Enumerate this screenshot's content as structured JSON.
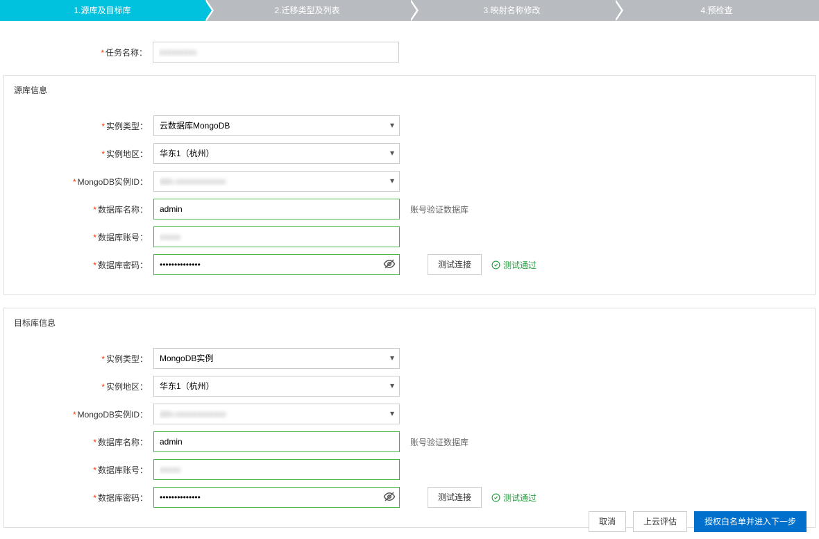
{
  "steps": {
    "s1": "1.源库及目标库",
    "s2": "2.迁移类型及列表",
    "s3": "3.映射名称修改",
    "s4": "4.预检查"
  },
  "task": {
    "label": "任务名称：",
    "value": "xxxxxxxxx"
  },
  "source": {
    "title": "源库信息",
    "instanceType": {
      "label": "实例类型：",
      "value": "云数据库MongoDB"
    },
    "region": {
      "label": "实例地区：",
      "value": "华东1（杭州）"
    },
    "instanceId": {
      "label": "MongoDB实例ID：",
      "value": "dds-xxxxxxxxxxxx"
    },
    "dbName": {
      "label": "数据库名称：",
      "value": "admin",
      "hint": "账号验证数据库"
    },
    "account": {
      "label": "数据库账号：",
      "value": "xxxxx"
    },
    "password": {
      "label": "数据库密码：",
      "value": "••••••••••••••"
    },
    "testBtn": "测试连接",
    "testResult": "测试通过"
  },
  "target": {
    "title": "目标库信息",
    "instanceType": {
      "label": "实例类型：",
      "value": "MongoDB实例"
    },
    "region": {
      "label": "实例地区：",
      "value": "华东1（杭州）"
    },
    "instanceId": {
      "label": "MongoDB实例ID：",
      "value": "dds-xxxxxxxxxxxx"
    },
    "dbName": {
      "label": "数据库名称：",
      "value": "admin",
      "hint": "账号验证数据库"
    },
    "account": {
      "label": "数据库账号：",
      "value": "xxxxx"
    },
    "password": {
      "label": "数据库密码：",
      "value": "••••••••••••••"
    },
    "testBtn": "测试连接",
    "testResult": "测试通过"
  },
  "footer": {
    "cancel": "取消",
    "evaluate": "上云评估",
    "next": "授权白名单并进入下一步"
  }
}
